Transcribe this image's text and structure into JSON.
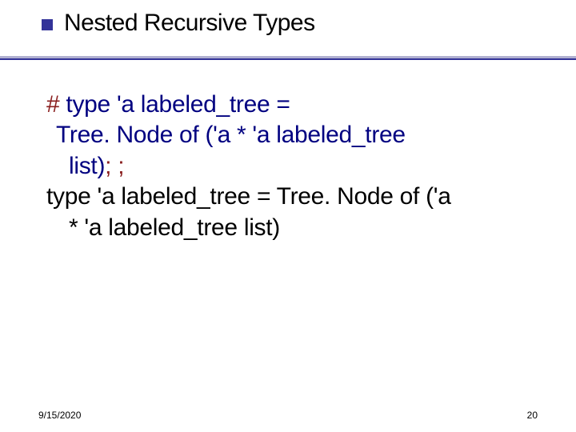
{
  "title": "Nested Recursive Types",
  "code": {
    "l1_hash": "#",
    "l1_rest": " type 'a labeled_tree =",
    "l2": " Tree. Node of ('a * 'a labeled_tree",
    "l3_pre": "list)",
    "l3_post": "; ;",
    "l4": "type 'a labeled_tree = Tree. Node of ('a",
    "l5": "* 'a labeled_tree list)"
  },
  "footer": {
    "date": "9/15/2020",
    "page": "20"
  }
}
